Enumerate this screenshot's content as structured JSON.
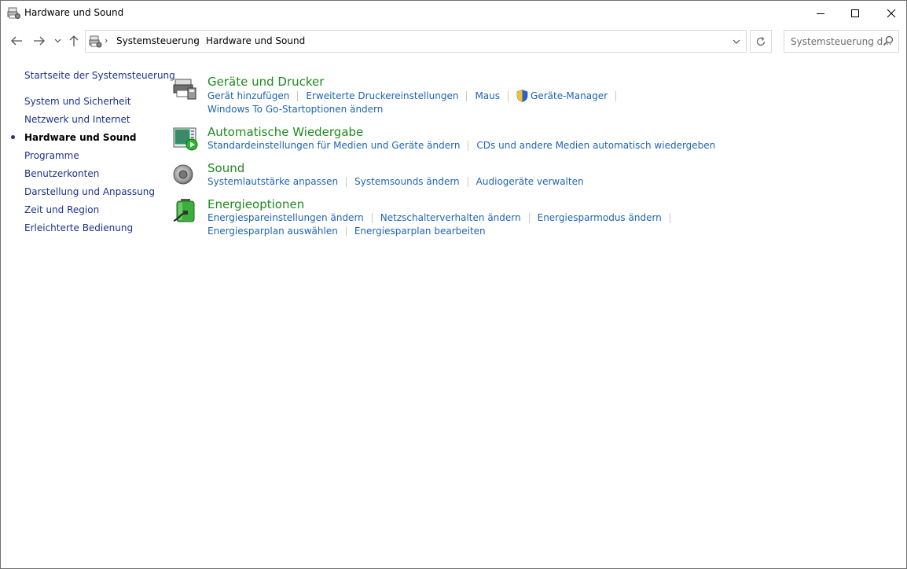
{
  "window": {
    "title": "Hardware und Sound",
    "controls": {
      "minimize": "minimize-icon",
      "maximize": "maximize-icon",
      "close": "close-icon"
    }
  },
  "navigation": {
    "breadcrumbs": [
      "Systemsteuerung",
      "Hardware und Sound"
    ],
    "search_placeholder": "Systemsteuerung d..."
  },
  "sidebar": {
    "home": "Startseite der Systemsteuerung",
    "items": [
      {
        "label": "System und Sicherheit",
        "active": false
      },
      {
        "label": "Netzwerk und Internet",
        "active": false
      },
      {
        "label": "Hardware und Sound",
        "active": true
      },
      {
        "label": "Programme",
        "active": false
      },
      {
        "label": "Benutzerkonten",
        "active": false
      },
      {
        "label": "Darstellung und Anpassung",
        "active": false
      },
      {
        "label": "Zeit und Region",
        "active": false
      },
      {
        "label": "Erleichterte Bedienung",
        "active": false
      }
    ]
  },
  "categories": [
    {
      "title": "Geräte und Drucker",
      "icon": "printer-devices-icon",
      "rows": [
        [
          "Gerät hinzufügen",
          "Erweiterte Druckereinstellungen",
          "Maus",
          "Geräte-Manager"
        ],
        [
          "Windows To Go-Startoptionen ändern"
        ]
      ]
    },
    {
      "title": "Automatische Wiedergabe",
      "icon": "autoplay-icon",
      "rows": [
        [
          "Standardeinstellungen für Medien und Geräte ändern",
          "CDs und andere Medien automatisch wiedergeben"
        ]
      ]
    },
    {
      "title": "Sound",
      "icon": "speaker-icon",
      "rows": [
        [
          "Systemlautstärke anpassen",
          "Systemsounds ändern",
          "Audiogeräte verwalten"
        ]
      ]
    },
    {
      "title": "Energieoptionen",
      "icon": "battery-icon",
      "rows": [
        [
          "Energiespareinstellungen ändern",
          "Netzschalterverhalten ändern",
          "Energiesparmodus ändern"
        ],
        [
          "Energiesparplan auswählen",
          "Energiesparplan bearbeiten"
        ]
      ]
    }
  ],
  "colors": {
    "category_title": "#1e8a1e",
    "link": "#1e64b4",
    "sidebar_link": "#1e3287"
  }
}
